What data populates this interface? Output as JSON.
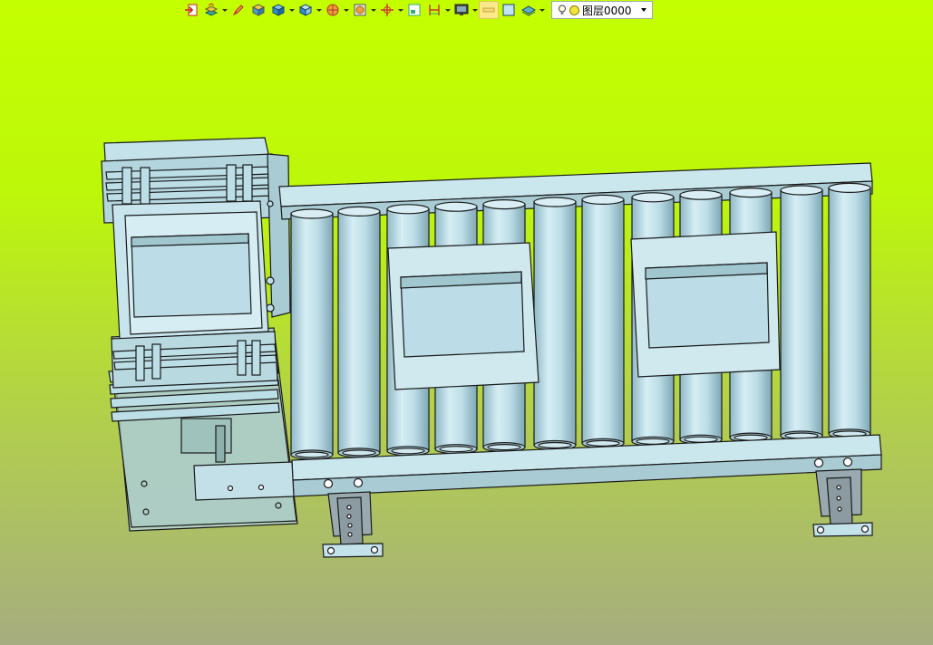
{
  "toolbar": {
    "buttons": [
      {
        "icon": "exit-icon",
        "dropdown": false
      },
      {
        "icon": "layer-stack-icon",
        "dropdown": true
      },
      {
        "icon": "pencil-icon",
        "dropdown": false
      },
      {
        "icon": "box-shaded-icon",
        "dropdown": false
      },
      {
        "icon": "cube-icon",
        "dropdown": true
      },
      {
        "icon": "cube-view-icon",
        "dropdown": true
      },
      {
        "icon": "sphere-section-icon",
        "dropdown": true
      },
      {
        "icon": "render-box-icon",
        "dropdown": true
      },
      {
        "icon": "triad-icon",
        "dropdown": true
      },
      {
        "icon": "frame-icon",
        "dropdown": false
      },
      {
        "icon": "dimension-icon",
        "dropdown": true
      },
      {
        "icon": "monitor-icon",
        "dropdown": true
      },
      {
        "icon": "highlight-icon",
        "dropdown": false,
        "active": true
      },
      {
        "icon": "plane-icon",
        "dropdown": false
      },
      {
        "icon": "layers-icon",
        "dropdown": true
      }
    ],
    "layer_combo": {
      "value": "图层0000"
    }
  },
  "scene": {
    "background_top": "#c4ff00",
    "background_bottom": "#a6ad80",
    "part_color": "#bcdee7",
    "edge_color": "#1a1a1a"
  }
}
